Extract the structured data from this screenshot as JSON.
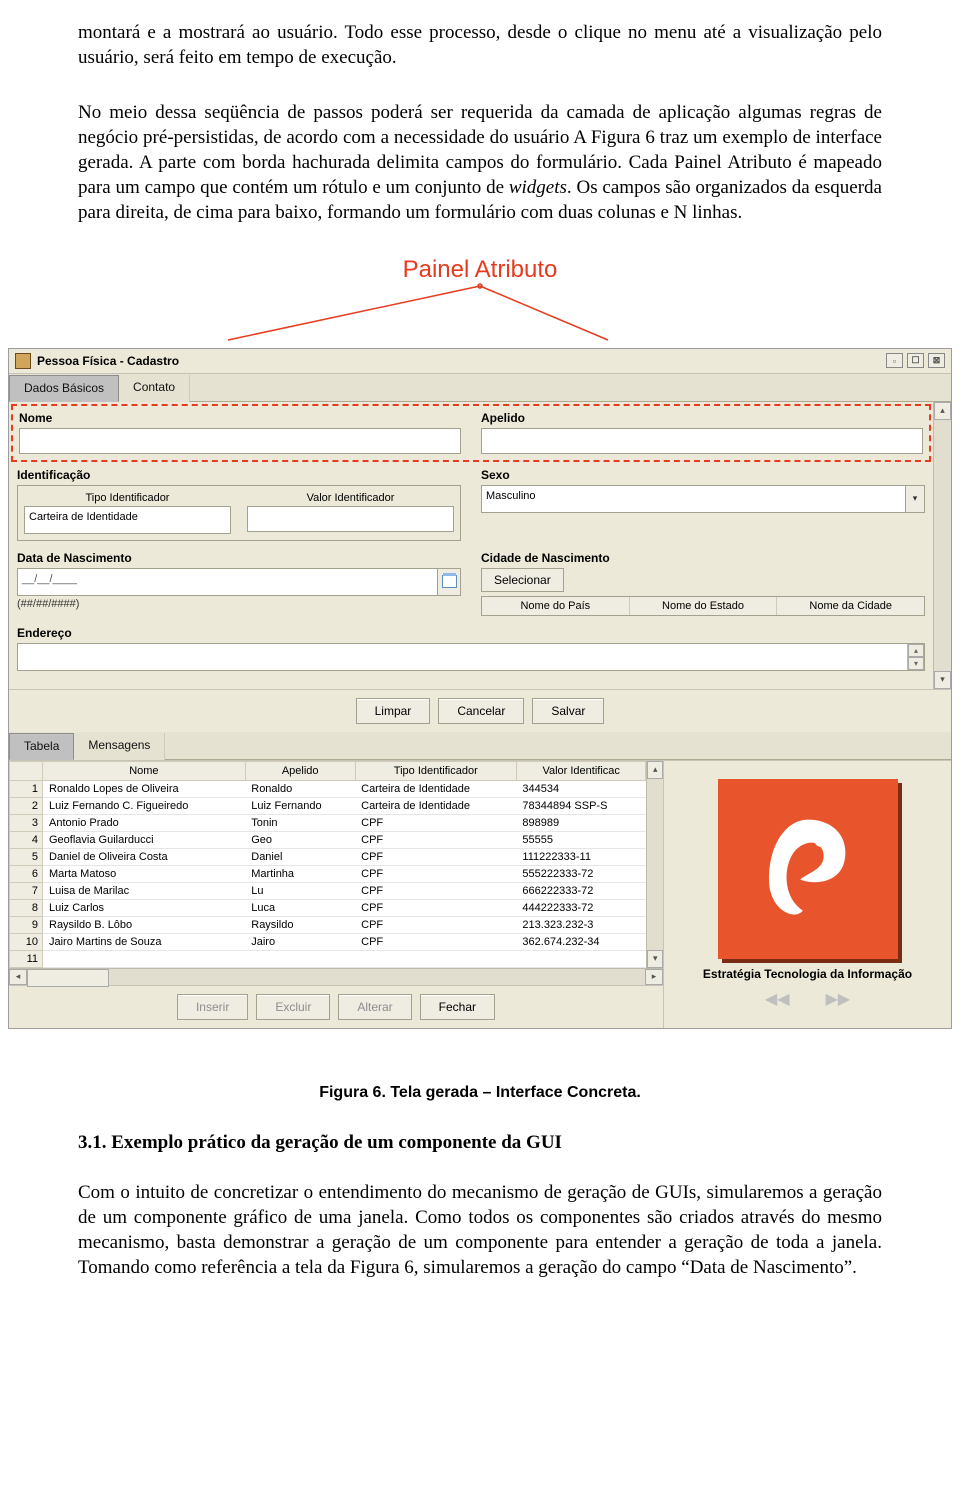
{
  "text": {
    "p1": "montará e a mostrará ao usuário. Todo esse processo, desde o clique no menu até a visualização pelo usuário, será feito em tempo de execução.",
    "p2a": "No meio dessa seqüência de passos poderá ser requerida da camada de aplicação algumas regras de negócio pré-persistidas, de acordo com a necessidade do usuário A Figura 6 traz um exemplo de interface gerada. A parte com borda hachurada delimita campos do formulário. Cada Painel Atributo é mapeado para um campo que contém um rótulo e um conjunto de ",
    "p2_em": "widgets",
    "p2b": ". Os campos são organizados da esquerda para direita, de cima para baixo, formando um formulário com duas colunas e N linhas.",
    "painel_label": "Painel Atributo",
    "caption": "Figura 6. Tela gerada – Interface Concreta.",
    "h2": "3.1. Exemplo prático da geração de um componente da GUI",
    "p3": "Com o intuito de concretizar o entendimento do mecanismo de geração de GUIs, simularemos a geração de um componente gráfico de uma janela. Como todos os componentes são criados através do mesmo mecanismo, basta demonstrar a geração de um componente para entender a geração de toda a janela. Tomando como referência a tela da Figura 6, simularemos a geração do campo “Data de Nascimento”."
  },
  "window": {
    "title": "Pessoa Física - Cadastro",
    "tabs": [
      "Dados Básicos",
      "Contato"
    ],
    "form": {
      "nome": "Nome",
      "apelido": "Apelido",
      "ident_group": "Identificação",
      "tipo_ident": "Tipo Identificador",
      "tipo_ident_val": "Carteira de Identidade",
      "valor_ident": "Valor Identificador",
      "sexo": "Sexo",
      "sexo_val": "Masculino",
      "data_nasc": "Data de Nascimento",
      "data_placeholder": "__/__/____",
      "data_hint": "(##/##/####)",
      "cidade_nasc": "Cidade de Nascimento",
      "selecionar": "Selecionar",
      "col_pais": "Nome do País",
      "col_estado": "Nome do Estado",
      "col_cidade": "Nome da Cidade",
      "endereco": "Endereço"
    },
    "buttons": {
      "limpar": "Limpar",
      "cancelar": "Cancelar",
      "salvar": "Salvar",
      "inserir": "Inserir",
      "excluir": "Excluir",
      "alterar": "Alterar",
      "fechar": "Fechar"
    },
    "lower_tabs": [
      "Tabela",
      "Mensagens"
    ],
    "table": {
      "headers": [
        "",
        "Nome",
        "Apelido",
        "Tipo Identificador",
        "Valor Identificac"
      ],
      "rows": [
        [
          "1",
          "Ronaldo Lopes de Oliveira",
          "Ronaldo",
          "Carteira de Identidade",
          "344534"
        ],
        [
          "2",
          "Luiz Fernando C. Figueiredo",
          "Luiz Fernando",
          "Carteira de Identidade",
          "78344894 SSP-S"
        ],
        [
          "3",
          "Antonio Prado",
          "Tonin",
          "CPF",
          "898989"
        ],
        [
          "4",
          "Geoflavia Guilarducci",
          "Geo",
          "CPF",
          "55555"
        ],
        [
          "5",
          "Daniel de Oliveira Costa",
          "Daniel",
          "CPF",
          "111222333-11"
        ],
        [
          "6",
          "Marta Matoso",
          "Martinha",
          "CPF",
          "555222333-72"
        ],
        [
          "7",
          "Luisa de Marilac",
          "Lu",
          "CPF",
          "666222333-72"
        ],
        [
          "8",
          "Luiz Carlos",
          "Luca",
          "CPF",
          "444222333-72"
        ],
        [
          "9",
          "Raysildo B. Lôbo",
          "Raysildo",
          "CPF",
          "213.323.232-3"
        ],
        [
          "10",
          "Jairo Martins de Souza",
          "Jairo",
          "CPF",
          "362.674.232-34"
        ],
        [
          "11",
          "",
          "",
          "",
          ""
        ]
      ]
    },
    "logo_caption": "Estratégia Tecnologia da Informação"
  }
}
